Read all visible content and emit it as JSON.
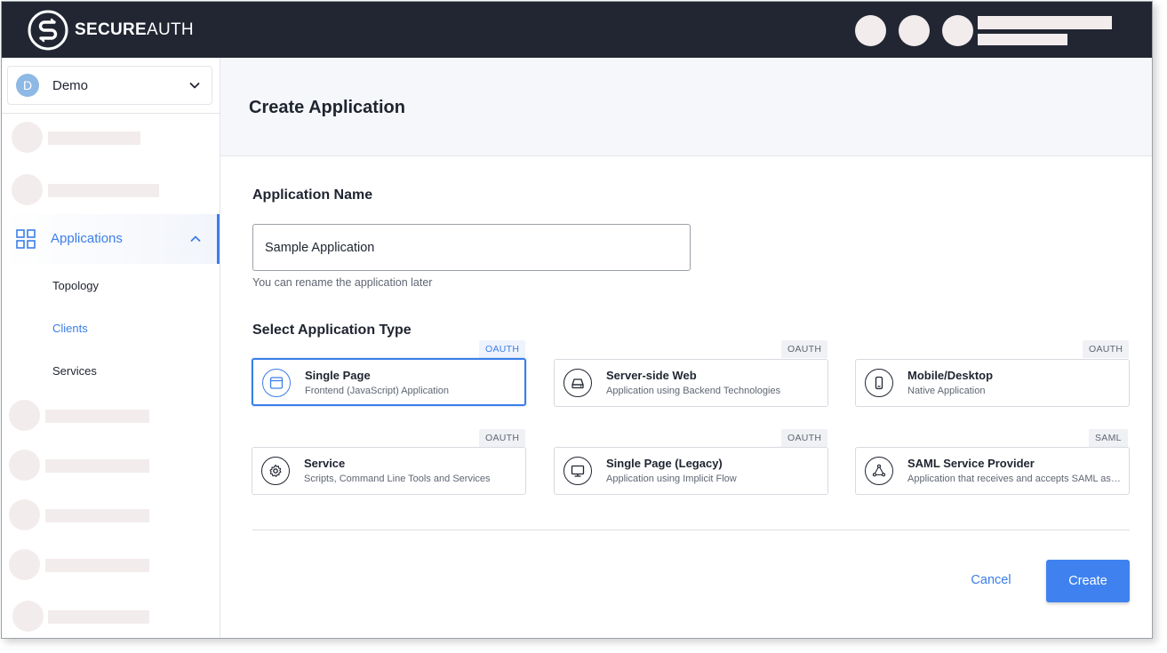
{
  "brand": {
    "name_bold": "SECURE",
    "name_light": "AUTH",
    "icon": "secureauth-logo-icon"
  },
  "header": {
    "avatar_icons": [
      "placeholder-circle",
      "placeholder-circle",
      "placeholder-circle"
    ]
  },
  "sidebar": {
    "tenant": {
      "avatar_letter": "D",
      "name": "Demo",
      "icon": "chevron-down-icon"
    },
    "applications": {
      "label": "Applications",
      "icon": "grid-icon",
      "toggle_icon": "chevron-up-icon"
    },
    "sub_items": [
      {
        "label": "Topology",
        "active": false
      },
      {
        "label": "Clients",
        "active": true
      },
      {
        "label": "Services",
        "active": false
      }
    ]
  },
  "main": {
    "title": "Create Application",
    "name_section": {
      "label": "Application Name",
      "value": "Sample Application",
      "help": "You can rename the application later"
    },
    "type_section": {
      "label": "Select Application Type",
      "types": [
        {
          "title": "Single Page",
          "desc": "Frontend (JavaScript) Application",
          "badge": "OAUTH",
          "icon": "browser-window-icon",
          "selected": true
        },
        {
          "title": "Server-side Web",
          "desc": "Application using Backend Technologies",
          "badge": "OAUTH",
          "icon": "server-drive-icon",
          "selected": false
        },
        {
          "title": "Mobile/Desktop",
          "desc": "Native Application",
          "badge": "OAUTH",
          "icon": "mobile-device-icon",
          "selected": false
        },
        {
          "title": "Service",
          "desc": "Scripts, Command Line Tools and Services",
          "badge": "OAUTH",
          "icon": "gear-icon",
          "selected": false
        },
        {
          "title": "Single Page (Legacy)",
          "desc": "Application using Implicit Flow",
          "badge": "OAUTH",
          "icon": "monitor-icon",
          "selected": false
        },
        {
          "title": "SAML Service Provider",
          "desc": "Application that receives and accepts SAML assertions",
          "badge": "SAML",
          "icon": "triangle-nodes-icon",
          "selected": false
        }
      ]
    },
    "actions": {
      "cancel": "Cancel",
      "create": "Create"
    }
  },
  "colors": {
    "header_bg": "#222633",
    "accent": "#3b7ee8",
    "placeholder": "#f3ecec",
    "page_head_bg": "#f5f7fb"
  }
}
